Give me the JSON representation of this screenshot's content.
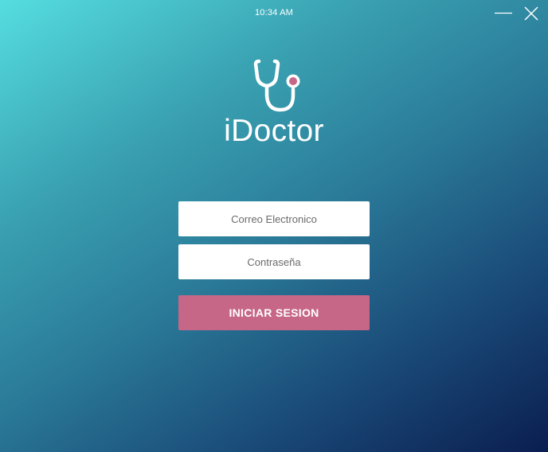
{
  "status_bar": {
    "time": "10:34 AM"
  },
  "window_controls": {
    "minimize_icon": "minimize-icon",
    "close_icon": "close-icon"
  },
  "brand": {
    "logo_icon": "stethoscope-icon",
    "name": "iDoctor"
  },
  "login_form": {
    "email_placeholder": "Correo Electronico",
    "email_value": "",
    "password_placeholder": "Contraseña",
    "password_value": "",
    "submit_label": "INICIAR SESION"
  },
  "colors": {
    "gradient_start": "#55dde0",
    "gradient_end": "#0a1e50",
    "accent": "#c76787",
    "text_on_dark": "#ffffff",
    "field_background": "#ffffff"
  }
}
